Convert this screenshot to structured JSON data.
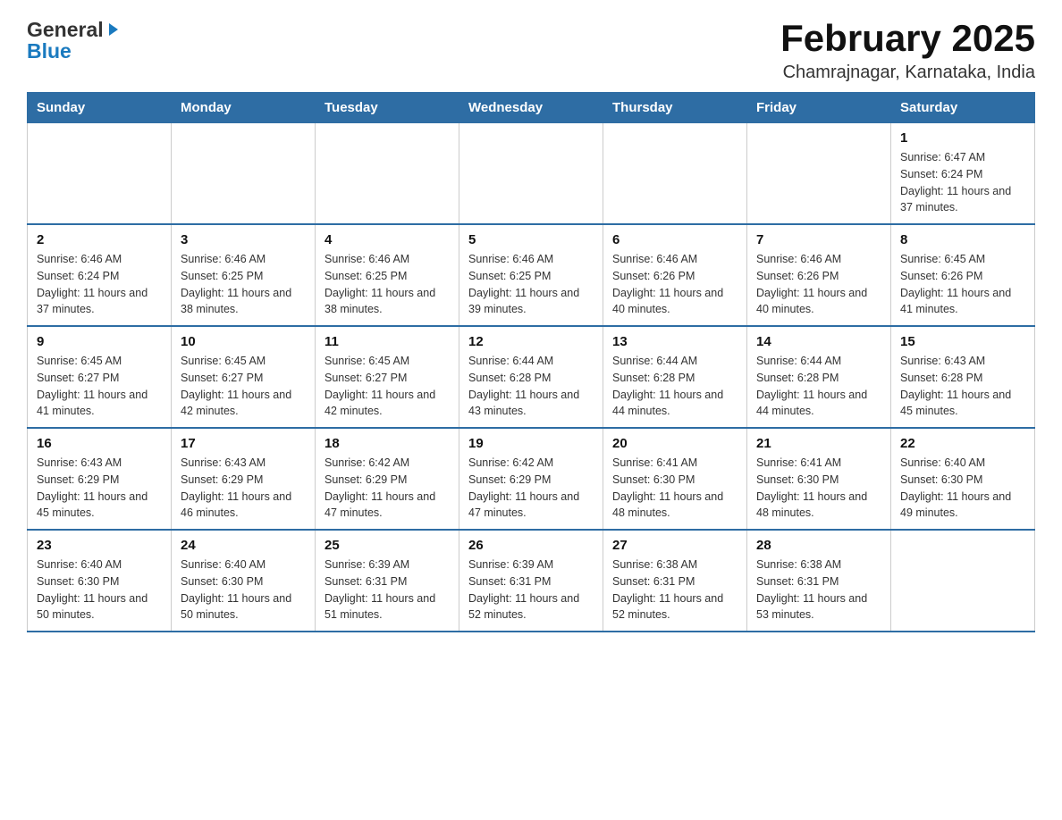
{
  "logo": {
    "general": "General",
    "blue": "Blue",
    "arrow_symbol": "▶"
  },
  "header": {
    "month_year": "February 2025",
    "location": "Chamrajnagar, Karnataka, India"
  },
  "weekdays": [
    "Sunday",
    "Monday",
    "Tuesday",
    "Wednesday",
    "Thursday",
    "Friday",
    "Saturday"
  ],
  "weeks": [
    [
      {
        "day": "",
        "sunrise": "",
        "sunset": "",
        "daylight": ""
      },
      {
        "day": "",
        "sunrise": "",
        "sunset": "",
        "daylight": ""
      },
      {
        "day": "",
        "sunrise": "",
        "sunset": "",
        "daylight": ""
      },
      {
        "day": "",
        "sunrise": "",
        "sunset": "",
        "daylight": ""
      },
      {
        "day": "",
        "sunrise": "",
        "sunset": "",
        "daylight": ""
      },
      {
        "day": "",
        "sunrise": "",
        "sunset": "",
        "daylight": ""
      },
      {
        "day": "1",
        "sunrise": "Sunrise: 6:47 AM",
        "sunset": "Sunset: 6:24 PM",
        "daylight": "Daylight: 11 hours and 37 minutes."
      }
    ],
    [
      {
        "day": "2",
        "sunrise": "Sunrise: 6:46 AM",
        "sunset": "Sunset: 6:24 PM",
        "daylight": "Daylight: 11 hours and 37 minutes."
      },
      {
        "day": "3",
        "sunrise": "Sunrise: 6:46 AM",
        "sunset": "Sunset: 6:25 PM",
        "daylight": "Daylight: 11 hours and 38 minutes."
      },
      {
        "day": "4",
        "sunrise": "Sunrise: 6:46 AM",
        "sunset": "Sunset: 6:25 PM",
        "daylight": "Daylight: 11 hours and 38 minutes."
      },
      {
        "day": "5",
        "sunrise": "Sunrise: 6:46 AM",
        "sunset": "Sunset: 6:25 PM",
        "daylight": "Daylight: 11 hours and 39 minutes."
      },
      {
        "day": "6",
        "sunrise": "Sunrise: 6:46 AM",
        "sunset": "Sunset: 6:26 PM",
        "daylight": "Daylight: 11 hours and 40 minutes."
      },
      {
        "day": "7",
        "sunrise": "Sunrise: 6:46 AM",
        "sunset": "Sunset: 6:26 PM",
        "daylight": "Daylight: 11 hours and 40 minutes."
      },
      {
        "day": "8",
        "sunrise": "Sunrise: 6:45 AM",
        "sunset": "Sunset: 6:26 PM",
        "daylight": "Daylight: 11 hours and 41 minutes."
      }
    ],
    [
      {
        "day": "9",
        "sunrise": "Sunrise: 6:45 AM",
        "sunset": "Sunset: 6:27 PM",
        "daylight": "Daylight: 11 hours and 41 minutes."
      },
      {
        "day": "10",
        "sunrise": "Sunrise: 6:45 AM",
        "sunset": "Sunset: 6:27 PM",
        "daylight": "Daylight: 11 hours and 42 minutes."
      },
      {
        "day": "11",
        "sunrise": "Sunrise: 6:45 AM",
        "sunset": "Sunset: 6:27 PM",
        "daylight": "Daylight: 11 hours and 42 minutes."
      },
      {
        "day": "12",
        "sunrise": "Sunrise: 6:44 AM",
        "sunset": "Sunset: 6:28 PM",
        "daylight": "Daylight: 11 hours and 43 minutes."
      },
      {
        "day": "13",
        "sunrise": "Sunrise: 6:44 AM",
        "sunset": "Sunset: 6:28 PM",
        "daylight": "Daylight: 11 hours and 44 minutes."
      },
      {
        "day": "14",
        "sunrise": "Sunrise: 6:44 AM",
        "sunset": "Sunset: 6:28 PM",
        "daylight": "Daylight: 11 hours and 44 minutes."
      },
      {
        "day": "15",
        "sunrise": "Sunrise: 6:43 AM",
        "sunset": "Sunset: 6:28 PM",
        "daylight": "Daylight: 11 hours and 45 minutes."
      }
    ],
    [
      {
        "day": "16",
        "sunrise": "Sunrise: 6:43 AM",
        "sunset": "Sunset: 6:29 PM",
        "daylight": "Daylight: 11 hours and 45 minutes."
      },
      {
        "day": "17",
        "sunrise": "Sunrise: 6:43 AM",
        "sunset": "Sunset: 6:29 PM",
        "daylight": "Daylight: 11 hours and 46 minutes."
      },
      {
        "day": "18",
        "sunrise": "Sunrise: 6:42 AM",
        "sunset": "Sunset: 6:29 PM",
        "daylight": "Daylight: 11 hours and 47 minutes."
      },
      {
        "day": "19",
        "sunrise": "Sunrise: 6:42 AM",
        "sunset": "Sunset: 6:29 PM",
        "daylight": "Daylight: 11 hours and 47 minutes."
      },
      {
        "day": "20",
        "sunrise": "Sunrise: 6:41 AM",
        "sunset": "Sunset: 6:30 PM",
        "daylight": "Daylight: 11 hours and 48 minutes."
      },
      {
        "day": "21",
        "sunrise": "Sunrise: 6:41 AM",
        "sunset": "Sunset: 6:30 PM",
        "daylight": "Daylight: 11 hours and 48 minutes."
      },
      {
        "day": "22",
        "sunrise": "Sunrise: 6:40 AM",
        "sunset": "Sunset: 6:30 PM",
        "daylight": "Daylight: 11 hours and 49 minutes."
      }
    ],
    [
      {
        "day": "23",
        "sunrise": "Sunrise: 6:40 AM",
        "sunset": "Sunset: 6:30 PM",
        "daylight": "Daylight: 11 hours and 50 minutes."
      },
      {
        "day": "24",
        "sunrise": "Sunrise: 6:40 AM",
        "sunset": "Sunset: 6:30 PM",
        "daylight": "Daylight: 11 hours and 50 minutes."
      },
      {
        "day": "25",
        "sunrise": "Sunrise: 6:39 AM",
        "sunset": "Sunset: 6:31 PM",
        "daylight": "Daylight: 11 hours and 51 minutes."
      },
      {
        "day": "26",
        "sunrise": "Sunrise: 6:39 AM",
        "sunset": "Sunset: 6:31 PM",
        "daylight": "Daylight: 11 hours and 52 minutes."
      },
      {
        "day": "27",
        "sunrise": "Sunrise: 6:38 AM",
        "sunset": "Sunset: 6:31 PM",
        "daylight": "Daylight: 11 hours and 52 minutes."
      },
      {
        "day": "28",
        "sunrise": "Sunrise: 6:38 AM",
        "sunset": "Sunset: 6:31 PM",
        "daylight": "Daylight: 11 hours and 53 minutes."
      },
      {
        "day": "",
        "sunrise": "",
        "sunset": "",
        "daylight": ""
      }
    ]
  ]
}
